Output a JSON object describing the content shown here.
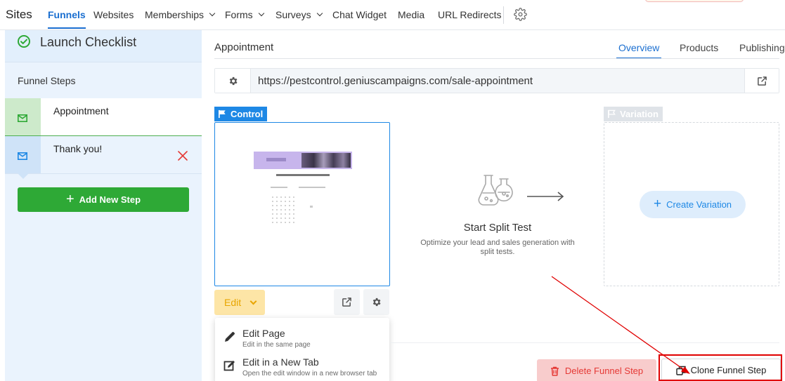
{
  "nav": {
    "brand": "Sites",
    "items": [
      {
        "label": "Funnels"
      },
      {
        "label": "Websites"
      },
      {
        "label": "Memberships"
      },
      {
        "label": "Forms"
      },
      {
        "label": "Surveys"
      },
      {
        "label": "Chat Widget"
      },
      {
        "label": "Media"
      },
      {
        "label": "URL Redirects"
      }
    ],
    "active": "Funnels",
    "settings_icon": "gear-icon"
  },
  "sidebar": {
    "checklist_label": "Launch Checklist",
    "steps_title": "Funnel Steps",
    "steps": [
      {
        "label": "Appointment",
        "selected": true
      },
      {
        "label": "Thank you!"
      }
    ],
    "add_step_label": "Add New Step"
  },
  "main": {
    "page_title": "Appointment",
    "tabs": [
      {
        "label": "Overview"
      },
      {
        "label": "Products"
      },
      {
        "label": "Publishing"
      }
    ],
    "active_tab": "Overview",
    "url": "https://pestcontrol.geniuscampaigns.com/sale-appointment",
    "control_label": "Control",
    "variation_label": "Variation",
    "edit_label": "Edit",
    "edit_menu": [
      {
        "title": "Edit Page",
        "desc": "Edit in the same page"
      },
      {
        "title": "Edit in a New Tab",
        "desc": "Open the edit window in a new browser tab"
      }
    ],
    "split_test_title": "Start Split Test",
    "split_test_desc": "Optimize your lead and sales generation with split tests.",
    "create_variation_label": "Create Variation",
    "delete_label": "Delete Funnel Step",
    "clone_label": "Clone Funnel Step"
  },
  "colors": {
    "accent": "#1b6fd0",
    "success": "#2ea936",
    "danger": "#e53935",
    "edit_bg": "#fde5a6",
    "annotation": "#e00000"
  }
}
